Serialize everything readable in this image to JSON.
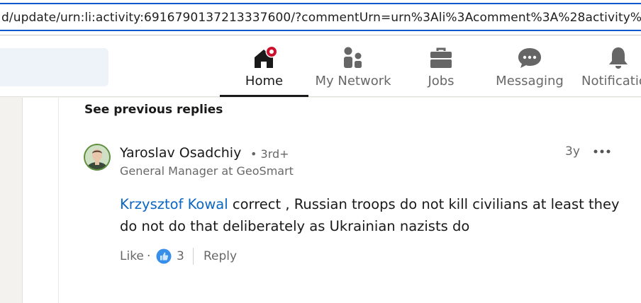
{
  "browser": {
    "url": "d/update/urn:li:activity:6916790137213337600/?commentUrn=urn%3Ali%3Acomment%3A%28activity%3A6916790137"
  },
  "nav": {
    "items": [
      {
        "label": "Home",
        "icon": "home-icon",
        "active": true
      },
      {
        "label": "My Network",
        "icon": "network-icon"
      },
      {
        "label": "Jobs",
        "icon": "briefcase-icon"
      },
      {
        "label": "Messaging",
        "icon": "chat-icon"
      },
      {
        "label": "Notificatio",
        "icon": "bell-icon"
      }
    ],
    "badge_color": "#cb112d"
  },
  "thread": {
    "see_previous": "See previous replies"
  },
  "comment": {
    "author": "Yaroslav Osadchiy",
    "degree": "• 3rd+",
    "headline": "General Manager at GeoSmart",
    "time": "3y",
    "mention": "Krzysztof Kowal",
    "text": " correct , Russian troops do not kill civilians at least they do not do that deliberately as Ukrainian nazists do",
    "like_label": "Like",
    "separator": "·",
    "reaction_icon": "thumbs-up-icon",
    "reaction_count": "3",
    "reply_label": "Reply"
  },
  "colors": {
    "link": "#0a66c2",
    "url_focus": "#0b57d0"
  }
}
